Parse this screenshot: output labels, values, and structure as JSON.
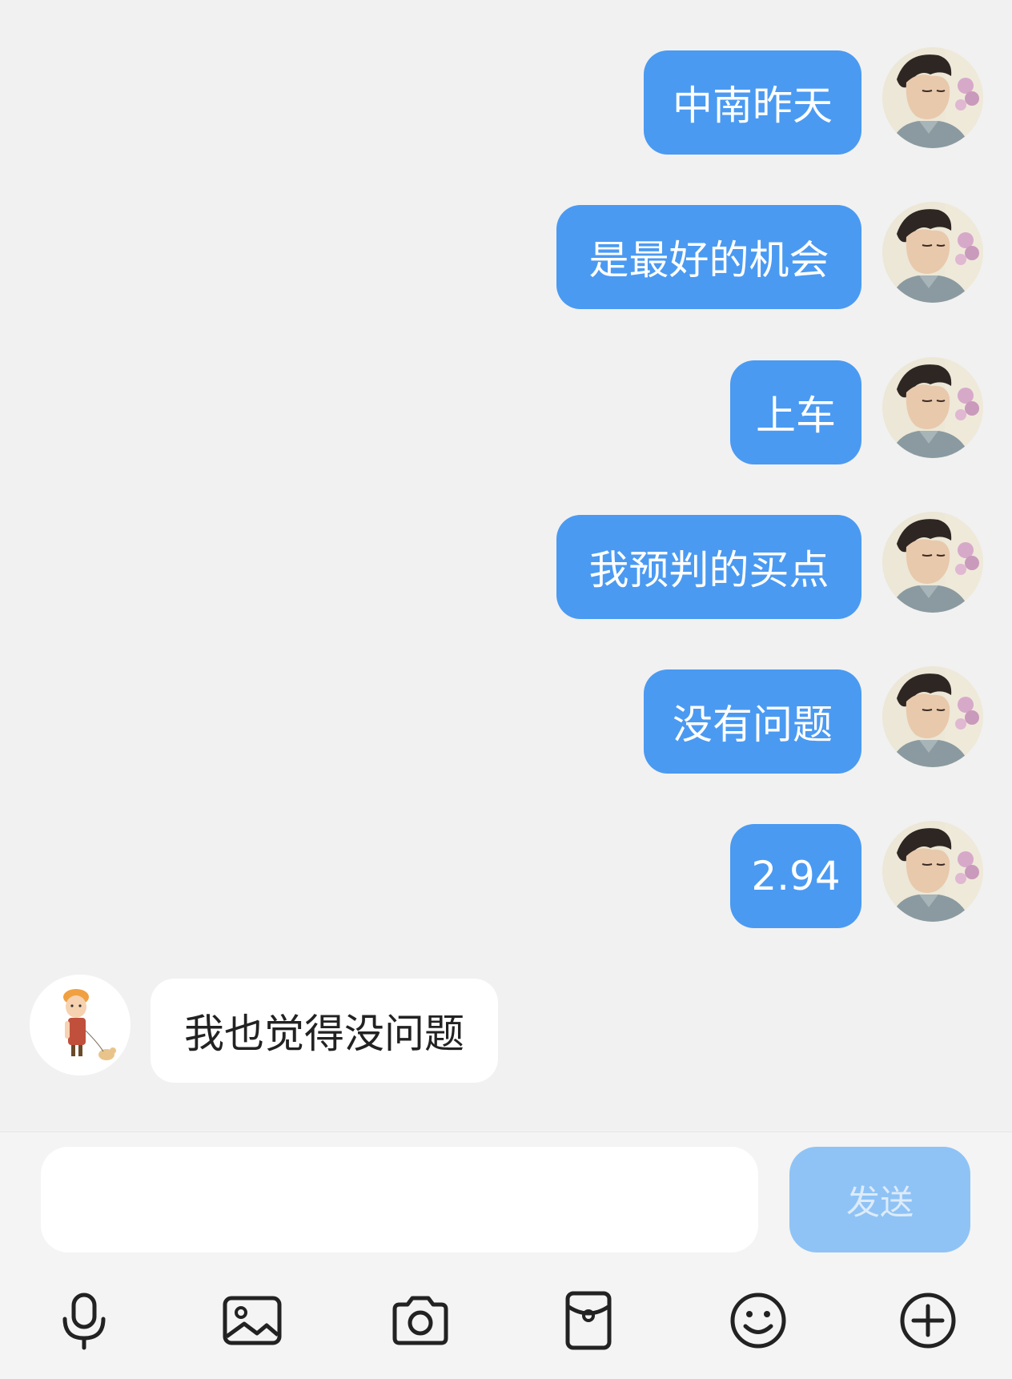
{
  "messages": [
    {
      "direction": "out",
      "text": "中南昨天"
    },
    {
      "direction": "out",
      "text": "是最好的机会"
    },
    {
      "direction": "out",
      "text": "上车"
    },
    {
      "direction": "out",
      "text": "我预判的买点"
    },
    {
      "direction": "out",
      "text": "没有问题"
    },
    {
      "direction": "out",
      "text": "2.94"
    },
    {
      "direction": "in",
      "text": "我也觉得没问题"
    }
  ],
  "composer": {
    "input_value": "",
    "send_label": "发送"
  },
  "toolbar": {
    "icons": [
      "microphone-icon",
      "image-icon",
      "camera-icon",
      "red-envelope-icon",
      "emoji-icon",
      "plus-icon"
    ]
  },
  "colors": {
    "outgoing_bubble": "#4a9af2",
    "incoming_bubble": "#ffffff",
    "send_button_disabled": "#8fc3f5",
    "background": "#f1f1f1"
  }
}
